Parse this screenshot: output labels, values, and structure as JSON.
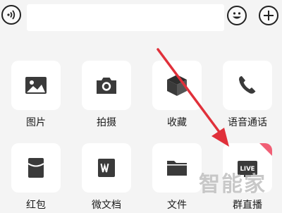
{
  "items": [
    {
      "label": "图片",
      "icon": "image-icon"
    },
    {
      "label": "拍摄",
      "icon": "camera-icon"
    },
    {
      "label": "收藏",
      "icon": "cube-icon"
    },
    {
      "label": "语音通话",
      "icon": "phone-icon"
    },
    {
      "label": "红包",
      "icon": "red-packet-icon"
    },
    {
      "label": "微文档",
      "icon": "word-doc-icon"
    },
    {
      "label": "文件",
      "icon": "folder-icon"
    },
    {
      "label": "群直播",
      "icon": "live-icon",
      "badge_text": "LIVE"
    }
  ],
  "watermark": "智能家",
  "colors": {
    "background": "#f4f4f4",
    "tile": "#ffffff",
    "icon": "#3a3a3a",
    "arrow": "#e0303a",
    "badge": "#f05f75"
  }
}
